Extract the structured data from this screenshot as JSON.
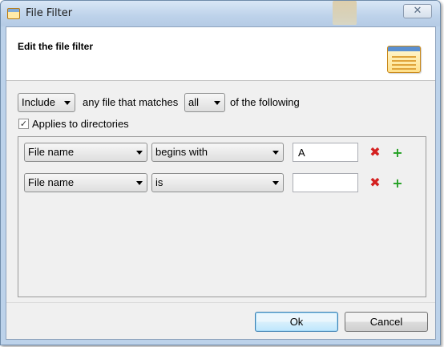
{
  "window": {
    "title": "File Filter",
    "close_symbol": "✕"
  },
  "header": {
    "title": "Edit the file filter",
    "icon": "file-filter-icon"
  },
  "filter": {
    "mode_value": "Include",
    "label_matches": "any file that matches",
    "match_value": "all",
    "label_following": "of the following",
    "applies_to_directories_checked": true,
    "applies_to_directories_label": "Applies to directories",
    "check_mark": "✓"
  },
  "rules": [
    {
      "attribute": "File name",
      "operator": "begins with",
      "value": "A",
      "remove_symbol": "✖",
      "add_symbol": "+"
    },
    {
      "attribute": "File name",
      "operator": "is",
      "value": "",
      "remove_symbol": "✖",
      "add_symbol": "+"
    }
  ],
  "buttons": {
    "ok_label": "Ok",
    "cancel_label": "Cancel"
  },
  "colors": {
    "remove": "#d42020",
    "add": "#22a022",
    "title_bar": "#bcd2ea"
  }
}
